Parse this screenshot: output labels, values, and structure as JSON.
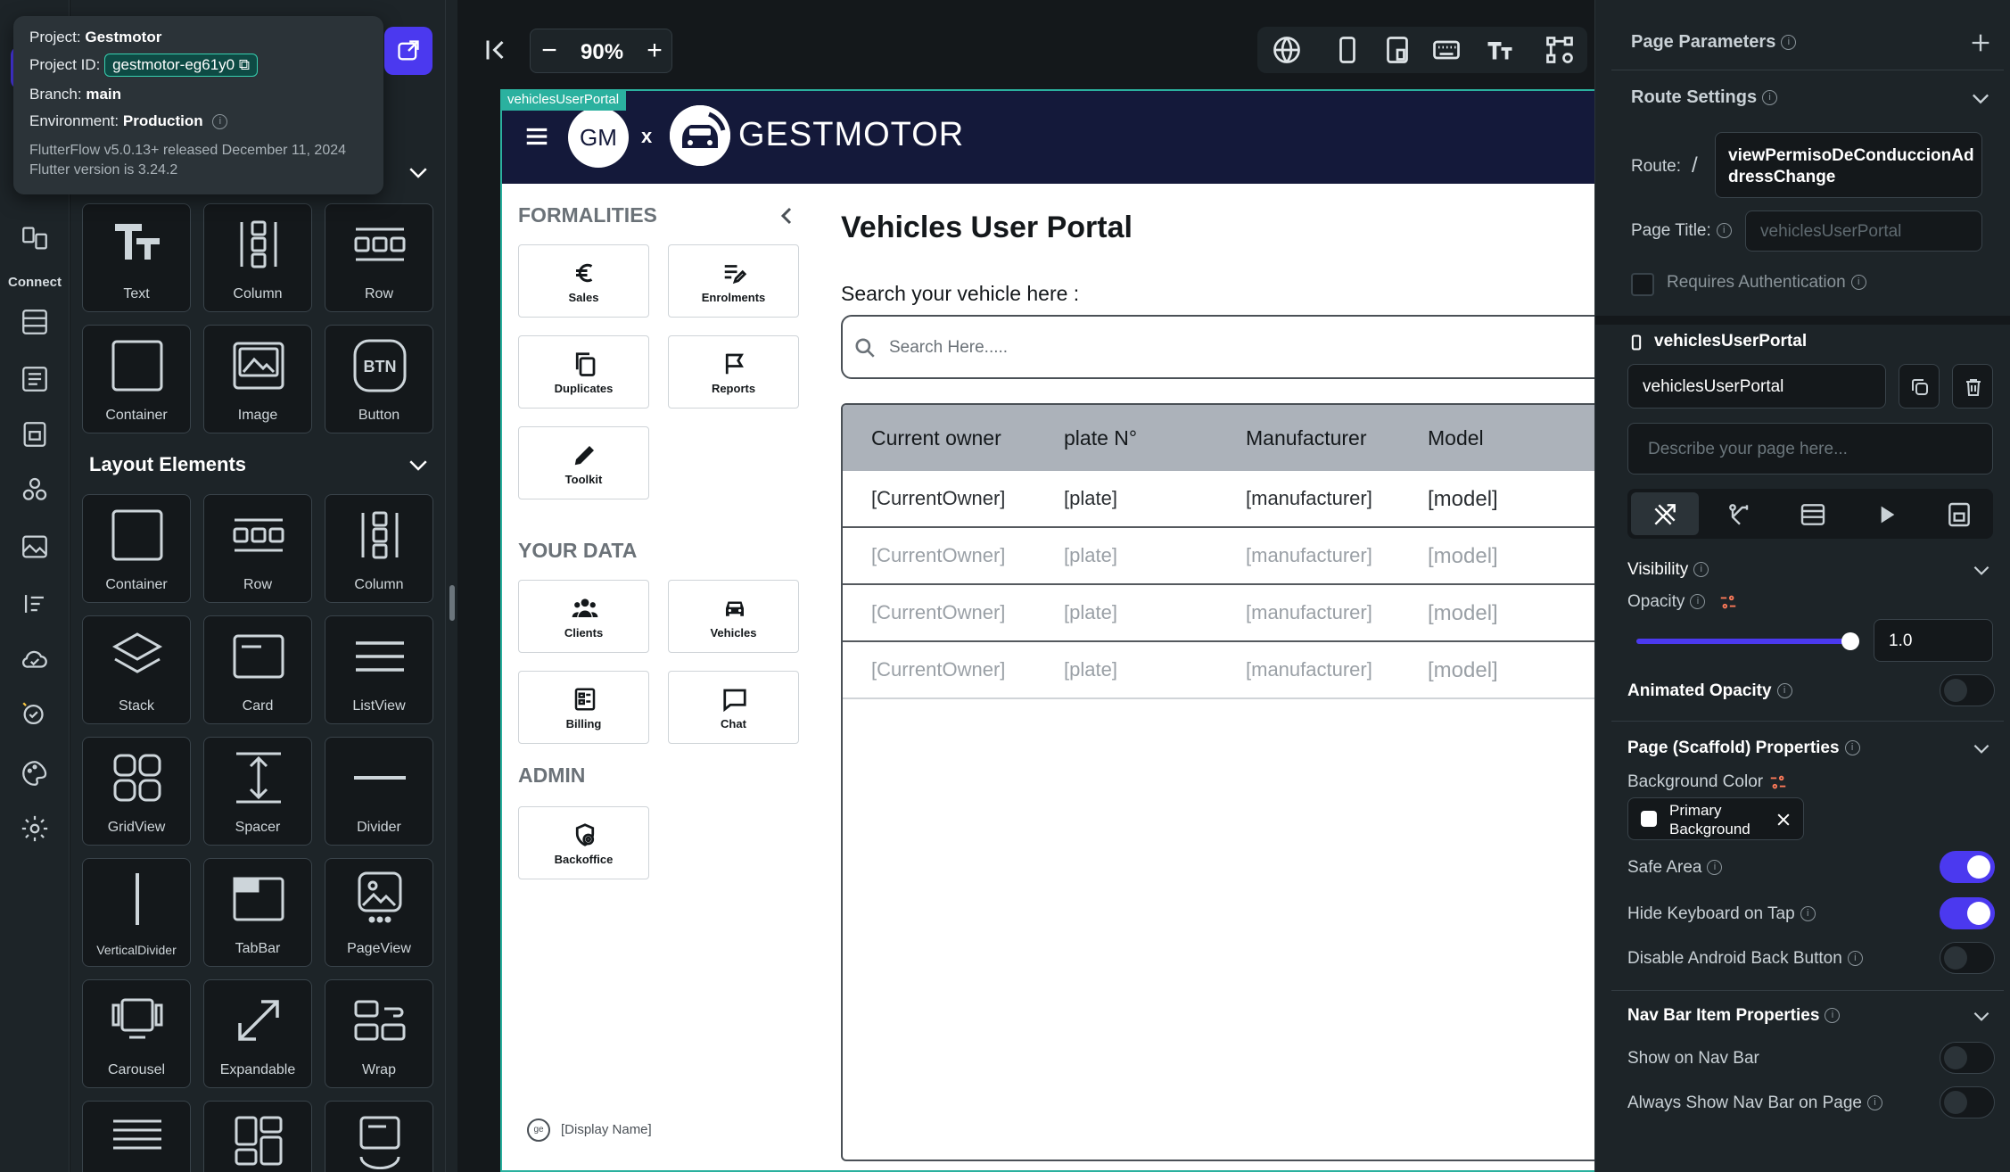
{
  "project_tooltip": {
    "project_label": "Project:",
    "project_value": "Gestmotor",
    "id_label": "Project ID:",
    "id_value": "gestmotor-eg61y0",
    "branch_label": "Branch:",
    "branch_value": "main",
    "env_label": "Environment:",
    "env_value": "Production",
    "version_line": "FlutterFlow v5.0.13+ released December 11, 2024",
    "flutter_line": "Flutter version is 3.24.2"
  },
  "rail": {
    "connect_label": "Connect"
  },
  "widget_panel": {
    "base_tiles": [
      {
        "label": "Text",
        "icon": "text-icon"
      },
      {
        "label": "Column",
        "icon": "column-icon"
      },
      {
        "label": "Row",
        "icon": "row-icon"
      },
      {
        "label": "Container",
        "icon": "container-icon"
      },
      {
        "label": "Image",
        "icon": "image-icon"
      },
      {
        "label": "Button",
        "icon": "button-icon"
      }
    ],
    "layout_title": "Layout Elements",
    "layout_tiles": [
      {
        "label": "Container",
        "icon": "container-icon"
      },
      {
        "label": "Row",
        "icon": "row-icon"
      },
      {
        "label": "Column",
        "icon": "column-icon"
      },
      {
        "label": "Stack",
        "icon": "stack-icon"
      },
      {
        "label": "Card",
        "icon": "card-icon"
      },
      {
        "label": "ListView",
        "icon": "listview-icon"
      },
      {
        "label": "GridView",
        "icon": "gridview-icon"
      },
      {
        "label": "Spacer",
        "icon": "spacer-icon"
      },
      {
        "label": "Divider",
        "icon": "divider-icon"
      },
      {
        "label": "VerticalDivider",
        "icon": "vertical-divider-icon"
      },
      {
        "label": "TabBar",
        "icon": "tabbar-icon"
      },
      {
        "label": "PageView",
        "icon": "pageview-icon"
      },
      {
        "label": "Carousel",
        "icon": "carousel-icon"
      },
      {
        "label": "Expandable",
        "icon": "expandable-icon"
      },
      {
        "label": "Wrap",
        "icon": "wrap-icon"
      }
    ]
  },
  "toolbar": {
    "zoom": "90%",
    "zoom_minus": "−",
    "zoom_plus": "+"
  },
  "canvas": {
    "tag": "vehiclesUserPortal",
    "header": {
      "gm_initials": "GM",
      "separator": "x",
      "brand": "GESTMOTOR",
      "color": "#14193a"
    },
    "sidebar": {
      "formalities_title": "FORMALITIES",
      "formalities": [
        {
          "label": "Sales",
          "icon": "euro-icon"
        },
        {
          "label": "Enrolments",
          "icon": "edit-list-icon"
        },
        {
          "label": "Duplicates",
          "icon": "copy-icon"
        },
        {
          "label": "Reports",
          "icon": "flag-icon"
        },
        {
          "label": "Toolkit",
          "icon": "pencil-icon"
        }
      ],
      "your_data_title": "YOUR DATA",
      "your_data": [
        {
          "label": "Clients",
          "icon": "users-icon"
        },
        {
          "label": "Vehicles",
          "icon": "car-icon"
        },
        {
          "label": "Billing",
          "icon": "billing-icon"
        },
        {
          "label": "Chat",
          "icon": "chat-icon"
        }
      ],
      "admin_title": "ADMIN",
      "admin": [
        {
          "label": "Backoffice",
          "icon": "backoffice-icon"
        }
      ],
      "display_name": "[Display Name]"
    },
    "main": {
      "title": "Vehicles User Portal",
      "search_label": "Search your vehicle here :",
      "search_placeholder": "Search Here.....",
      "table": {
        "columns": [
          "Current owner",
          "plate N°",
          "Manufacturer",
          "Model"
        ],
        "rows": [
          [
            "[CurrentOwner]",
            "[plate]",
            "[manufacturer]",
            "[model]"
          ],
          [
            "[CurrentOwner]",
            "[plate]",
            "[manufacturer]",
            "[model]"
          ],
          [
            "[CurrentOwner]",
            "[plate]",
            "[manufacturer]",
            "[model]"
          ],
          [
            "[CurrentOwner]",
            "[plate]",
            "[manufacturer]",
            "[model]"
          ]
        ]
      }
    }
  },
  "right_panel": {
    "page_parameters": "Page Parameters",
    "route_settings": "Route Settings",
    "route_label": "Route:",
    "route_slash": "/",
    "route_value": "viewPermisoDeConduccionAddressChange",
    "page_title_label": "Page Title:",
    "page_title_placeholder": "vehiclesUserPortal",
    "requires_auth": "Requires Authentication",
    "page_name_heading": "vehiclesUserPortal",
    "page_name_value": "vehiclesUserPortal",
    "describe_placeholder": "Describe your page here...",
    "visibility": "Visibility",
    "opacity_label": "Opacity",
    "opacity_value": "1.0",
    "opacity_fraction": 1.0,
    "animated_opacity": "Animated Opacity",
    "scaffold_props": "Page (Scaffold) Properties",
    "bg_color_label": "Background Color",
    "bg_color_value": "Primary Background",
    "safe_area": "Safe Area",
    "hide_keyboard": "Hide Keyboard on Tap",
    "disable_back": "Disable Android Back Button",
    "nav_bar_props": "Nav Bar Item Properties",
    "show_nav": "Show on Nav Bar",
    "always_show_nav": "Always Show Nav Bar on Page",
    "accent": "#4b39ef"
  }
}
